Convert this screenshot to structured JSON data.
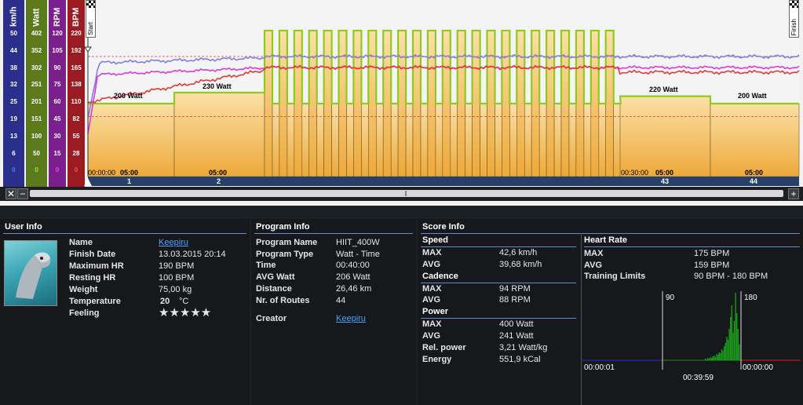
{
  "chart": {
    "scales": [
      {
        "unit": "km/h",
        "ticks": [
          "50",
          "44",
          "38",
          "32",
          "25",
          "19",
          "13",
          "6",
          "0"
        ],
        "color": "#2b2f8c",
        "zero_color": "#4c7cff"
      },
      {
        "unit": "Watt",
        "ticks": [
          "402",
          "352",
          "302",
          "251",
          "201",
          "151",
          "100",
          "50",
          "0"
        ],
        "color": "#5b7a1c",
        "zero_color": "#a6e02b"
      },
      {
        "unit": "RPM",
        "ticks": [
          "120",
          "105",
          "90",
          "75",
          "60",
          "45",
          "30",
          "15",
          "0"
        ],
        "color": "#7a1f8c",
        "zero_color": "#e04cf0"
      },
      {
        "unit": "BPM",
        "ticks": [
          "220",
          "192",
          "165",
          "138",
          "110",
          "82",
          "55",
          "28",
          "0"
        ],
        "color": "#9a1c22",
        "zero_color": "#ff4a4a"
      }
    ],
    "start_label": "Start",
    "finish_label": "Finish",
    "power_labels": [
      "200 Watt",
      "230 Watt",
      "220 Watt",
      "200 Watt"
    ],
    "time_labels": [
      "00:00:00",
      "05:00",
      "05:00",
      "00:30:00",
      "05:00",
      "05:00"
    ],
    "route_numbers": [
      "1",
      "2",
      "43",
      "44"
    ],
    "series": {
      "power_watts_segments": [
        200,
        230,
        "HIIT 400/200",
        220,
        200
      ],
      "colors": {
        "speed": "#7f7fe6",
        "cadence": "#d93ad9",
        "heart_rate": "#e03b3b",
        "power": "#8ecb1c"
      }
    },
    "hr_limit_bpm": [
      90,
      180
    ]
  },
  "scrollbar": {
    "left_icon": "fit-icon",
    "minus": "−",
    "plus": "+"
  },
  "user_info": {
    "title": "User Info",
    "rows": [
      {
        "label": "Name",
        "value": "Keepiru"
      },
      {
        "label": "Finish Date",
        "value": "13.03.2015 20:14"
      },
      {
        "label": "Maximum HR",
        "value": "190 BPM"
      },
      {
        "label": "Resting HR",
        "value": "100 BPM"
      },
      {
        "label": "Weight",
        "value": "75,00 kg"
      },
      {
        "label": "Temperature",
        "value": "20",
        "unit": "°C"
      },
      {
        "label": "Feeling",
        "value": "★★★★★"
      }
    ]
  },
  "program_info": {
    "title": "Program Info",
    "rows": [
      {
        "label": "Program Name",
        "value": "HIIT_400W"
      },
      {
        "label": "Program Type",
        "value": "Watt - Time"
      },
      {
        "label": "Time",
        "value": "00:40:00"
      },
      {
        "label": "AVG Watt",
        "value": "206 Watt"
      },
      {
        "label": "Distance",
        "value": "26,46 km"
      },
      {
        "label": "Nr. of Routes",
        "value": "44"
      }
    ],
    "creator_label": "Creator",
    "creator_value": "Keepiru"
  },
  "score_info": {
    "title": "Score Info",
    "speed": {
      "title": "Speed",
      "rows": [
        {
          "label": "MAX",
          "value": "42,6 km/h"
        },
        {
          "label": "AVG",
          "value": "39,68 km/h"
        }
      ]
    },
    "cadence": {
      "title": "Cadence",
      "rows": [
        {
          "label": "MAX",
          "value": "94 RPM"
        },
        {
          "label": "AVG",
          "value": "88 RPM"
        }
      ]
    },
    "power": {
      "title": "Power",
      "rows": [
        {
          "label": "MAX",
          "value": "400 Watt"
        },
        {
          "label": "AVG",
          "value": "241 Watt"
        },
        {
          "label": "Rel. power",
          "value": "3,21 Watt/kg"
        },
        {
          "label": "Energy",
          "value": "551,9 kCal"
        }
      ]
    },
    "heart_rate": {
      "title": "Heart Rate",
      "rows": [
        {
          "label": "MAX",
          "value": "175 BPM"
        },
        {
          "label": "AVG",
          "value": "159 BPM"
        },
        {
          "label": "Training Limits",
          "value": "90 BPM - 180 BPM"
        }
      ],
      "hist_low": "90",
      "hist_high": "180",
      "time_below": "00:00:01",
      "time_in": "00:39:59",
      "time_above": "00:00:00"
    }
  }
}
